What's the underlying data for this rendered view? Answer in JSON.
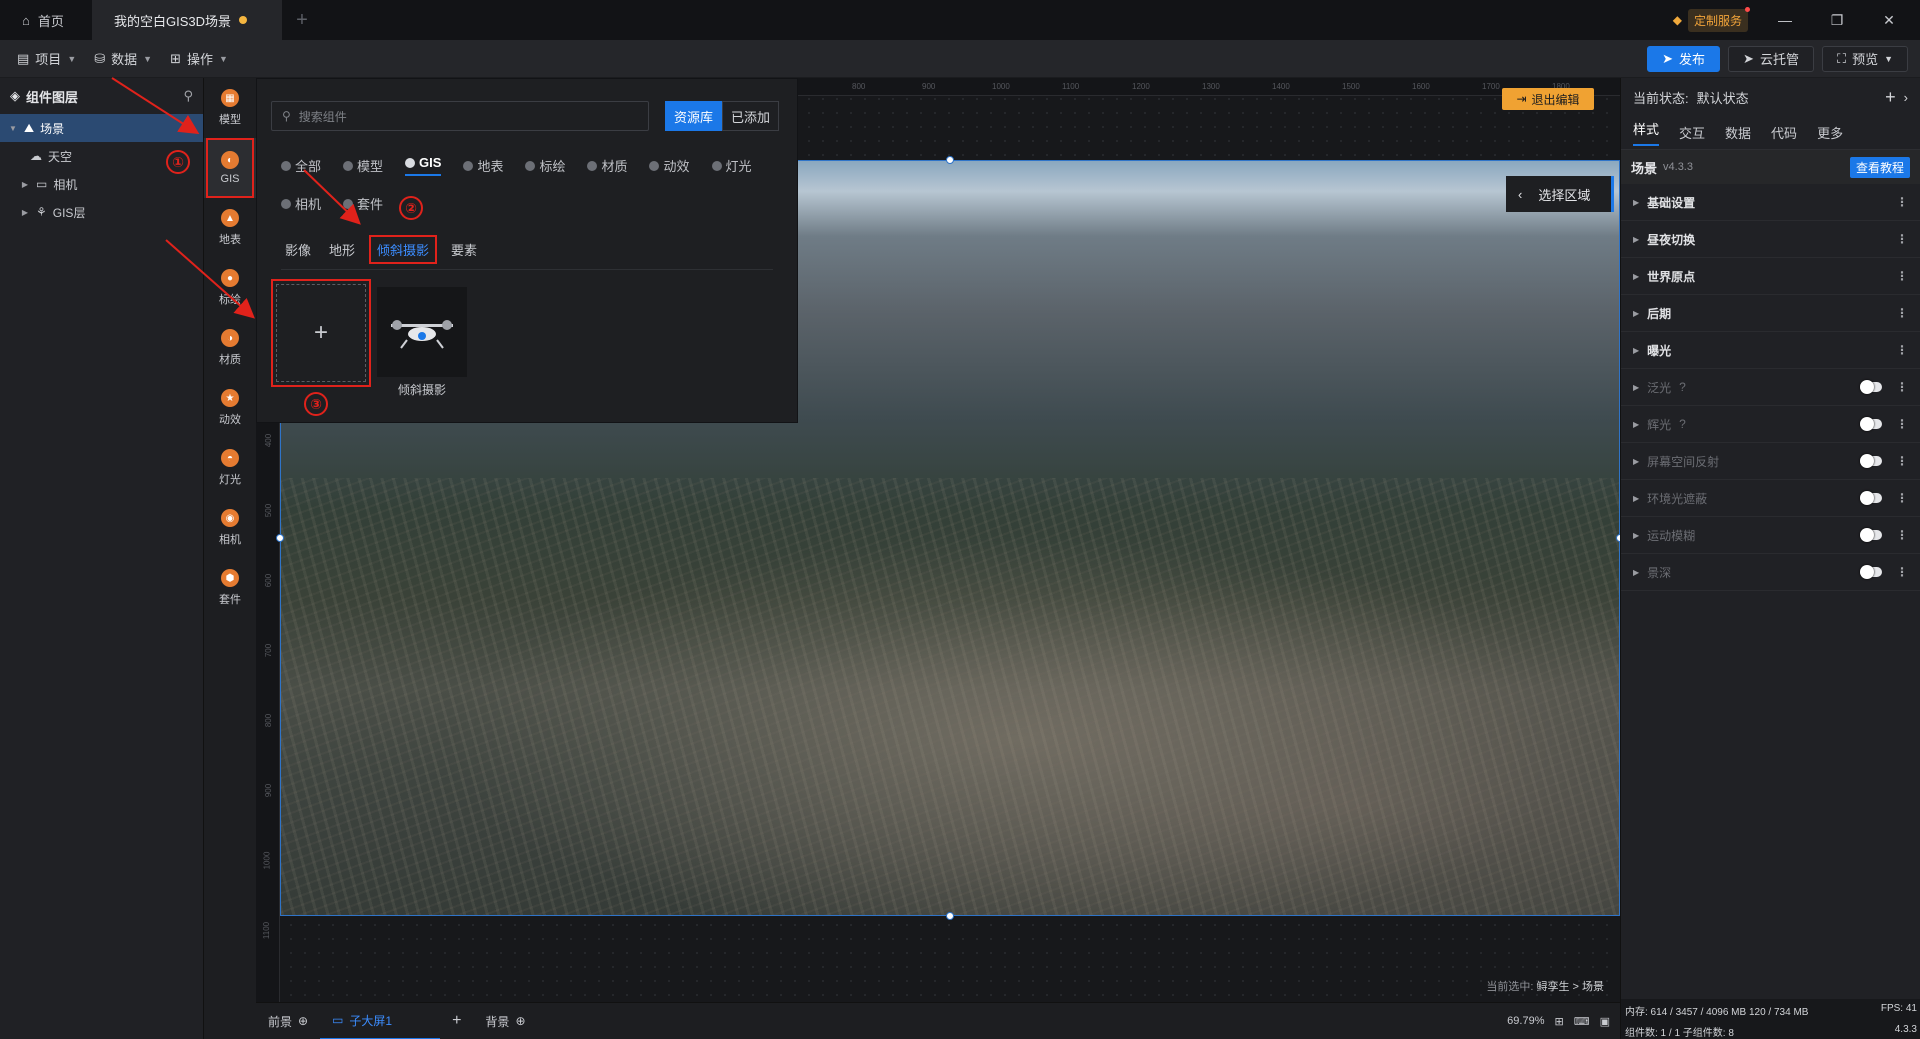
{
  "titlebar": {
    "tabs": [
      {
        "label": "首页"
      },
      {
        "label": "我的空白GIS3D场景"
      }
    ],
    "custom_service": "定制服务",
    "window_buttons": [
      "minimize",
      "restore",
      "close"
    ]
  },
  "menubar": {
    "items": [
      "项目",
      "数据",
      "操作"
    ],
    "publish": "发布",
    "cloud": "云托管",
    "preview": "预览"
  },
  "layer_panel": {
    "title": "组件图层",
    "tree": [
      {
        "label": "场景",
        "selected": true
      },
      {
        "label": "天空"
      },
      {
        "label": "相机"
      },
      {
        "label": "GIS层"
      }
    ]
  },
  "component_strip": [
    "模型",
    "GIS",
    "地表",
    "标绘",
    "材质",
    "动效",
    "灯光",
    "相机",
    "套件"
  ],
  "resource_popup": {
    "search_placeholder": "搜索组件",
    "library": "资源库",
    "added": "已添加",
    "categories": [
      "全部",
      "模型",
      "GIS",
      "地表",
      "标绘",
      "材质",
      "动效",
      "灯光",
      "相机",
      "套件"
    ],
    "active_category": "GIS",
    "subtabs": [
      "影像",
      "地形",
      "倾斜摄影",
      "要素"
    ],
    "active_subtab": "倾斜摄影",
    "add_symbol": "+",
    "tile_label": "倾斜摄影"
  },
  "annotations": [
    "①",
    "②",
    "③"
  ],
  "canvas": {
    "exit_edit": "退出编辑",
    "select_region": "选择区域",
    "selected_prefix": "当前选中: ",
    "selected_path": "鲟孪生 > 场景",
    "ruler_top": [
      "800",
      "900",
      "1000",
      "1100",
      "1200",
      "1300",
      "1400",
      "1500",
      "1600",
      "1700",
      "1800"
    ],
    "ruler_left": [
      "400",
      "500",
      "600",
      "700",
      "800",
      "900",
      "1000",
      "1100"
    ]
  },
  "bottombar": {
    "foreground": "前景",
    "child_screen": "子大屏1",
    "background": "背景",
    "zoom": "69.79%"
  },
  "right_panel": {
    "state_label": "当前状态:",
    "state_value": "默认状态",
    "tabs": [
      "样式",
      "交互",
      "数据",
      "代码",
      "更多"
    ],
    "scene_title": "场景",
    "scene_version": "v4.3.3",
    "tutorial": "查看教程",
    "sections": [
      {
        "label": "基础设置",
        "enabled": true
      },
      {
        "label": "昼夜切换",
        "enabled": true
      },
      {
        "label": "世界原点",
        "enabled": true
      },
      {
        "label": "后期",
        "enabled": true
      },
      {
        "label": "曝光",
        "enabled": true
      },
      {
        "label": "泛光",
        "enabled": false,
        "help": true
      },
      {
        "label": "辉光",
        "enabled": false,
        "help": true
      },
      {
        "label": "屏幕空间反射",
        "enabled": false
      },
      {
        "label": "环境光遮蔽",
        "enabled": false
      },
      {
        "label": "运动模糊",
        "enabled": false
      },
      {
        "label": "景深",
        "enabled": false
      }
    ],
    "status": {
      "memory": "内存: 614 / 3457 / 4096 MB  120 / 734 MB",
      "fps": "FPS: 41",
      "components": "组件数: 1 / 1   子组件数: 8",
      "version": "4.3.3"
    }
  },
  "colors": {
    "accent": "#1b78e8",
    "annotation": "#e0221b",
    "warning": "#f0a232"
  }
}
